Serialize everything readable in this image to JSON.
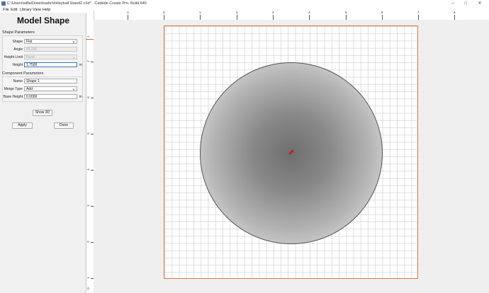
{
  "window": {
    "title": "C:\\Users\\willa\\Downloads\\Volleyball Stand2.c2d* - Carbide Create Pro, Build 645",
    "minimize": "–",
    "maximize": "□",
    "close": "✕"
  },
  "menu": [
    "File",
    "Edit",
    "Library",
    "View",
    "Help"
  ],
  "panel": {
    "title": "Model Shape",
    "shape_params_label": "Shape Parameters",
    "shape_label": "Shape",
    "shape_value": "Flat",
    "angle_label": "Angle",
    "angle_value": "45.000",
    "height_limit_label": "Height Limit",
    "height_limit_value": "None",
    "height_label": "Height",
    "height_value": "1.7500",
    "height_unit": "in",
    "component_params_label": "Component Parameters",
    "name_label": "Name",
    "name_value": "Shape 1",
    "merge_label": "Merge Type",
    "merge_value": "Add",
    "base_height_label": "Base Height",
    "base_height_value": "0.0000",
    "base_height_unit": "in",
    "show3d_label": "Show 3D",
    "apply_label": "Apply",
    "done_label": "Done"
  },
  "ruler": {
    "top_labels": [
      "-1",
      "0",
      "1",
      "2",
      "3",
      "4",
      "5",
      "6",
      "7",
      "8"
    ],
    "left_labels": [
      "1",
      "7",
      "6",
      "5",
      "4",
      "3",
      "2",
      "1",
      "0"
    ]
  },
  "colors": {
    "stock_border": "#e8743b",
    "origin_mark": "#e02020",
    "field_focus": "#3a76c4"
  },
  "icons": {
    "dropdown": "chevron-down-icon",
    "origin": "origin-marker-icon"
  }
}
